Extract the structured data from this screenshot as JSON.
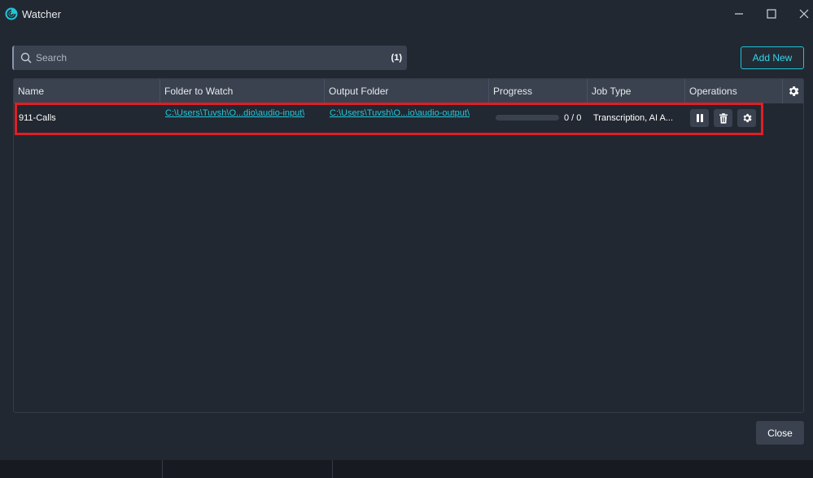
{
  "window": {
    "title": "Watcher"
  },
  "search": {
    "placeholder": "Search",
    "count": "(1)"
  },
  "toolbar": {
    "add_new_label": "Add New"
  },
  "table": {
    "columns": [
      "Name",
      "Folder to Watch",
      "Output Folder",
      "Progress",
      "Job Type",
      "Operations"
    ],
    "rows": [
      {
        "name": "911-Calls",
        "folder_to_watch": "C:\\Users\\Tuvsh\\O...dio\\audio-input\\",
        "output_folder": "C:\\Users\\Tuvsh\\O...io\\audio-output\\",
        "progress_text": "0 / 0",
        "progress_fraction": 0,
        "job_type": "Transcription, AI A..."
      }
    ]
  },
  "footer": {
    "close_label": "Close"
  },
  "colors": {
    "background": "#222831",
    "header": "#3a4250",
    "accent": "#20c4d8",
    "highlight": "#e01e26"
  },
  "icons": {
    "app": "watcher-logo-icon",
    "search": "search-icon",
    "columns_settings": "gear-icon",
    "pause": "pause-icon",
    "delete": "trash-icon",
    "row_settings": "gear-icon"
  }
}
